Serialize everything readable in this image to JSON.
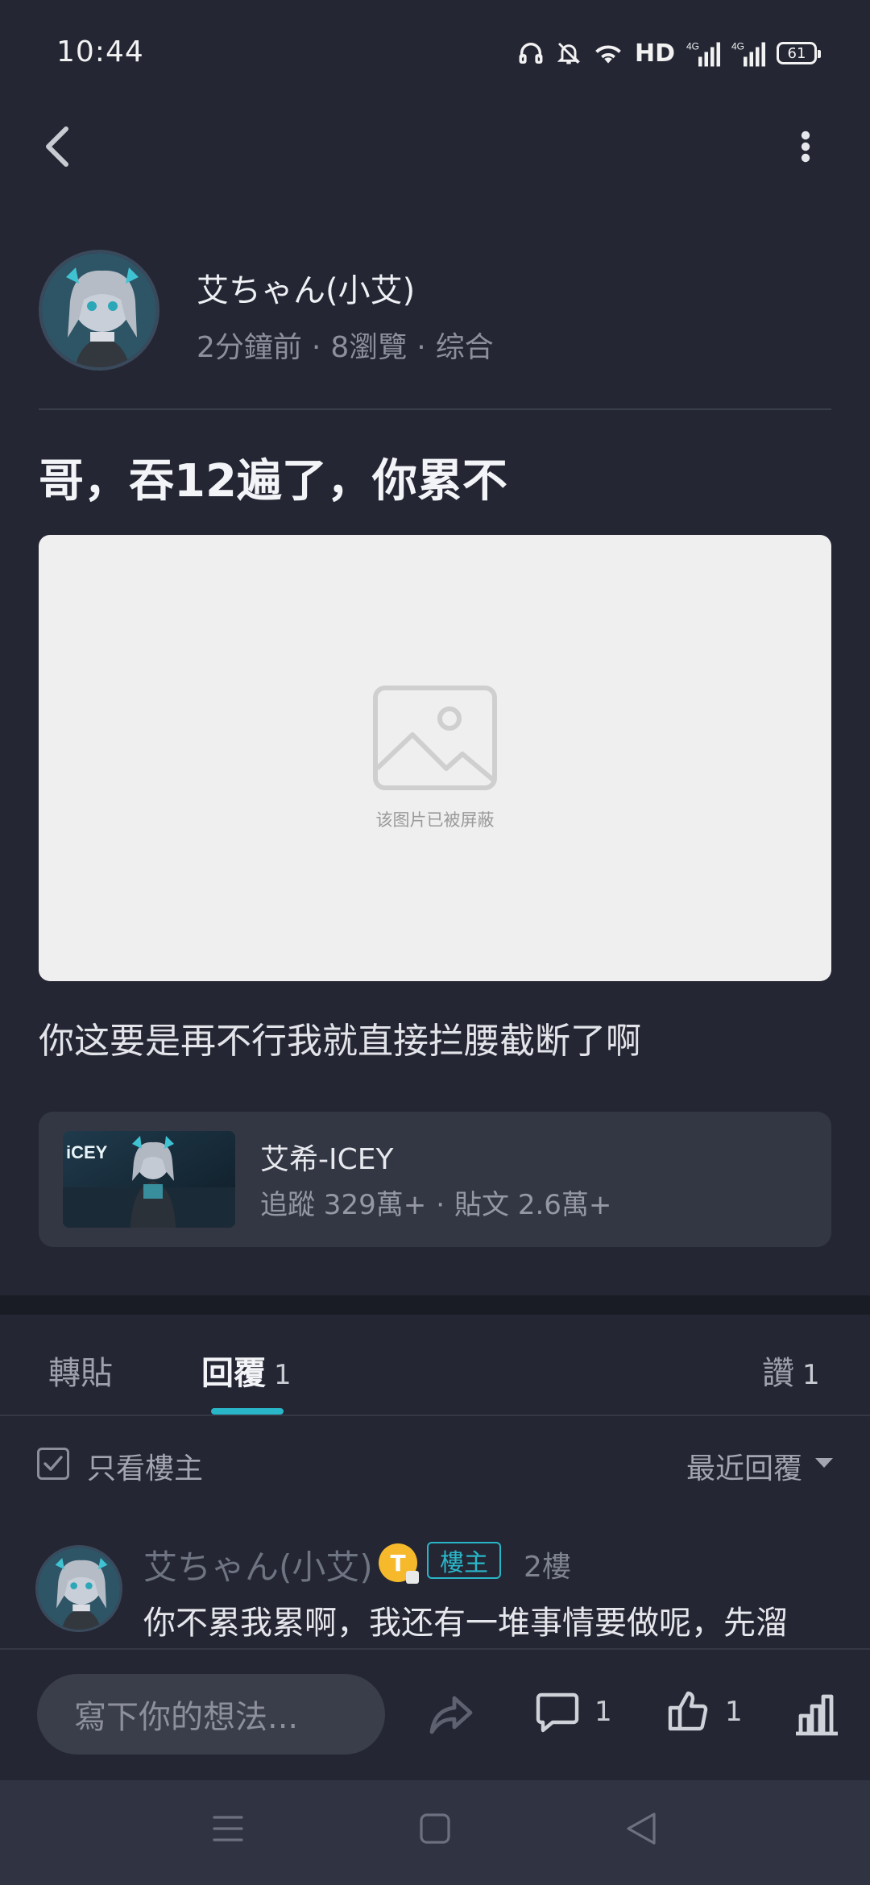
{
  "status_bar": {
    "time": "10:44",
    "hd_label": "HD",
    "network_1": "4G",
    "network_2": "4G",
    "battery": "61",
    "icons": [
      "headphones-icon",
      "bell-muted-icon",
      "wifi-icon",
      "hd-icon",
      "signal-icon",
      "signal-icon",
      "battery-icon"
    ]
  },
  "nav": {
    "back_icon": "chevron-left-icon",
    "more_icon": "more-vertical-icon"
  },
  "author": {
    "name": "艾ちゃん(小艾)",
    "time_ago": "2分鐘前",
    "views": "8瀏覽",
    "category": "综合",
    "separator": "·"
  },
  "post": {
    "title": "哥，吞12遍了，你累不",
    "image_blocked_text": "该图片已被屏蔽",
    "body": "你这要是再不行我就直接拦腰截断了啊"
  },
  "topic_card": {
    "name": "艾希-ICEY",
    "followers": "追蹤 329萬+",
    "posts": "貼文 2.6萬+",
    "separator": "·",
    "thumb_text": "iCEY"
  },
  "tabs": {
    "repost": "轉貼",
    "replies": "回覆",
    "replies_count": "1",
    "likes": "讚",
    "likes_count": "1"
  },
  "filter": {
    "only_op_label": "只看樓主",
    "sort_label": "最近回覆"
  },
  "reply": {
    "author": "艾ちゃん(小艾)",
    "level_badge": "T",
    "op_badge": "樓主",
    "floor": "2樓",
    "text": "你不累我累啊，我还有一堆事情要做呢，先溜"
  },
  "action_bar": {
    "input_placeholder": "寫下你的想法...",
    "comment_count": "1",
    "like_count": "1"
  },
  "colors": {
    "background": "#242633",
    "accent": "#29b6c8",
    "card": "#333744",
    "badge_gold": "#f5b92b"
  }
}
